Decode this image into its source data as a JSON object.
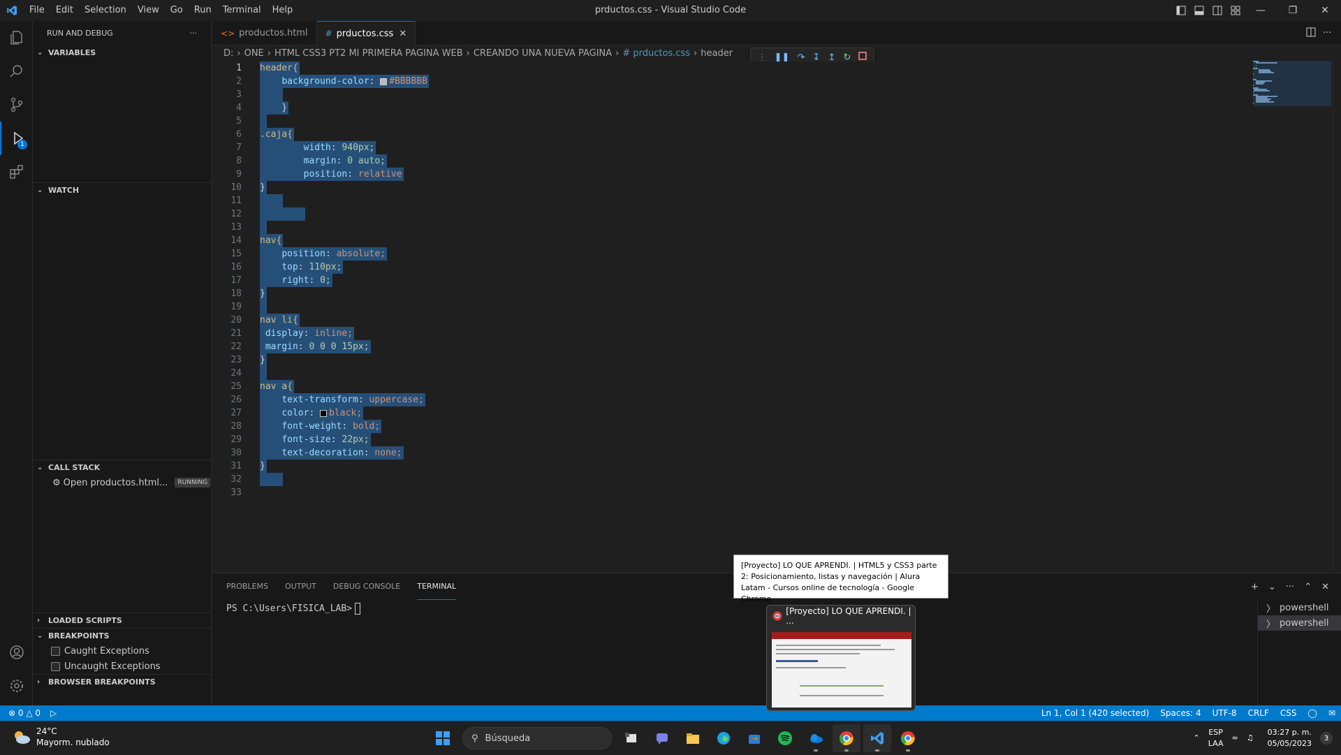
{
  "titlebar": {
    "title": "prductos.css - Visual Studio Code",
    "menu": [
      "File",
      "Edit",
      "Selection",
      "View",
      "Go",
      "Run",
      "Terminal",
      "Help"
    ]
  },
  "sidebar": {
    "header": "RUN AND DEBUG",
    "more": "···",
    "variables": "VARIABLES",
    "watch": "WATCH",
    "call_stack": "CALL STACK",
    "call_stack_item": "Open productos.html...",
    "call_stack_status": "RUNNING",
    "loaded_scripts": "LOADED SCRIPTS",
    "breakpoints": "BREAKPOINTS",
    "bp_caught": "Caught Exceptions",
    "bp_uncaught": "Uncaught Exceptions",
    "browser_breakpoints": "BROWSER BREAKPOINTS",
    "debug_badge": "1"
  },
  "tabs": [
    {
      "label": "productos.html",
      "icon": "<>"
    },
    {
      "label": "prductos.css",
      "icon": "#"
    }
  ],
  "breadcrumb": [
    "D:",
    "ONE",
    "HTML CSS3 PT2 MI PRIMERA PAGINA WEB",
    "CREANDO UNA NUEVA PAGINA",
    "# prductos.css",
    "header"
  ],
  "code_lines": [
    "header{",
    "    background-color: ▪#BBBBBB",
    "    ",
    "    }",
    "",
    ".caja{",
    "        width: 940px;",
    "        margin: 0 auto;",
    "        position: relative",
    "}",
    "    ",
    "        ",
    "",
    "nav{",
    "    position: absolute;",
    "    top: 110px;",
    "    right: 0;",
    "}",
    "",
    "nav li{",
    " display: inline;",
    " margin: 0 0 0 15px;",
    "}",
    "",
    "nav a{",
    "    text-transform: uppercase;",
    "    color: ▪black;",
    "    font-weight: bold;",
    "    font-size: 22px;",
    "    text-decoration: none;",
    "}",
    "    ",
    ""
  ],
  "panel": {
    "tabs": [
      "PROBLEMS",
      "OUTPUT",
      "DEBUG CONSOLE",
      "TERMINAL"
    ],
    "prompt": "PS C:\\Users\\FISICA_LAB>",
    "terminals": [
      "powershell",
      "powershell"
    ]
  },
  "statusbar": {
    "errors": "0",
    "warnings": "0",
    "position": "Ln 1, Col 1 (420 selected)",
    "spaces": "Spaces: 4",
    "encoding": "UTF-8",
    "eol": "CRLF",
    "language": "CSS"
  },
  "taskbar": {
    "temp": "24°C",
    "weather": "Mayorm. nublado",
    "search_placeholder": "Búsqueda",
    "lang1": "ESP",
    "lang2": "LAA",
    "time": "03:27 p. m.",
    "date": "05/05/2023",
    "notifications": "3"
  },
  "tooltip": {
    "text": "[Proyecto] LO QUE APRENDI. | HTML5 y CSS3 parte 2: Posicionamiento, listas y navegación | Alura Latam - Cursos online de tecnología - Google Chrome"
  },
  "thumbnail": {
    "title": "[Proyecto] LO QUE APRENDI. | ..."
  },
  "colors": {
    "accent": "#007acc",
    "selection": "#264f78",
    "swatch_header": "#BBBBBB",
    "swatch_black": "#000000"
  }
}
